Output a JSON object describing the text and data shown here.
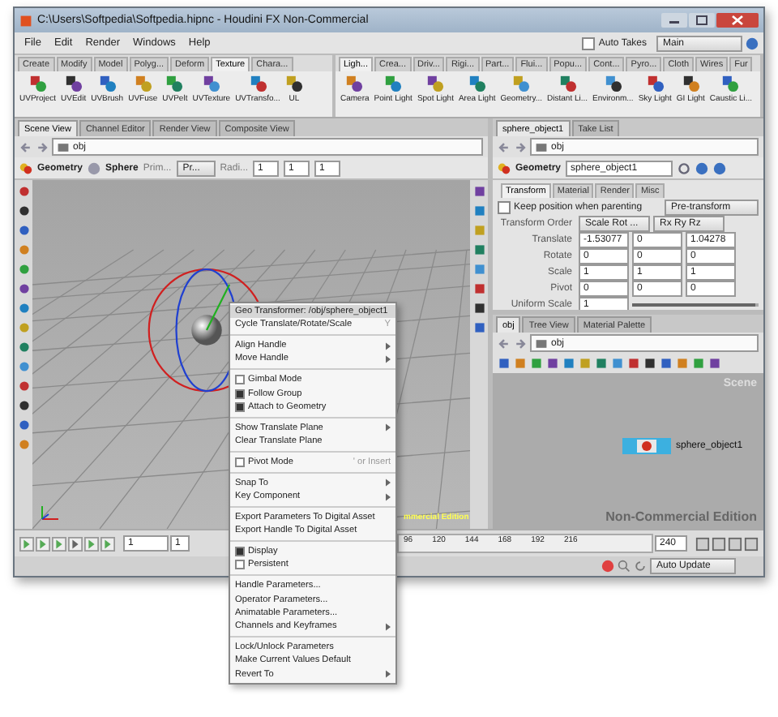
{
  "window": {
    "title": "C:\\Users\\Softpedia\\Softpedia.hipnc - Houdini FX Non-Commercial"
  },
  "menu_bar": [
    "File",
    "Edit",
    "Render",
    "Windows",
    "Help"
  ],
  "auto_takes": {
    "label": "Auto Takes",
    "checked": false
  },
  "take": "Main",
  "shelf_left": {
    "tabs": [
      {
        "label": "Create",
        "selected": false
      },
      {
        "label": "Modify",
        "selected": false
      },
      {
        "label": "Model",
        "selected": false
      },
      {
        "label": "Polyg...",
        "selected": false
      },
      {
        "label": "Deform",
        "selected": false
      },
      {
        "label": "Texture",
        "selected": true
      },
      {
        "label": "Chara...",
        "selected": false
      }
    ],
    "tools": [
      "UVProject",
      "UVEdit",
      "UVBrush",
      "UVFuse",
      "UVPelt",
      "UVTexture",
      "UVTransfo...",
      "UL"
    ]
  },
  "shelf_right": {
    "tabs": [
      {
        "label": "Ligh...",
        "selected": true
      },
      {
        "label": "Crea...",
        "selected": false
      },
      {
        "label": "Driv...",
        "selected": false
      },
      {
        "label": "Rigi...",
        "selected": false
      },
      {
        "label": "Part...",
        "selected": false
      },
      {
        "label": "Flui...",
        "selected": false
      },
      {
        "label": "Popu...",
        "selected": false
      },
      {
        "label": "Cont...",
        "selected": false
      },
      {
        "label": "Pyro...",
        "selected": false
      },
      {
        "label": "Cloth",
        "selected": false
      },
      {
        "label": "Wires",
        "selected": false
      },
      {
        "label": "Fur",
        "selected": false
      }
    ],
    "tools": [
      "Camera",
      "Point Light",
      "Spot Light",
      "Area Light",
      "Geometry...",
      "Distant Li...",
      "Environm...",
      "Sky Light",
      "GI Light",
      "Caustic Li..."
    ]
  },
  "scene_view": {
    "tabs": [
      {
        "label": "Scene View",
        "selected": true
      },
      {
        "label": "Channel Editor",
        "selected": false
      },
      {
        "label": "Render View",
        "selected": false
      },
      {
        "label": "Composite View",
        "selected": false
      }
    ],
    "path": "obj",
    "node_type": "Geometry",
    "shape": "Sphere",
    "prim_label": "Prim...",
    "prim_value": "Pr...",
    "radius_label": "Radi...",
    "radius": [
      "1",
      "1",
      "1"
    ],
    "watermark": "mmercial Edition"
  },
  "parameters": {
    "tabs": [
      {
        "label": "sphere_object1",
        "selected": true
      },
      {
        "label": "Take List",
        "selected": false
      }
    ],
    "path": "obj",
    "node_type": "Geometry",
    "node_name": "sphere_object1",
    "param_tabs": [
      {
        "label": "Transform",
        "selected": true
      },
      {
        "label": "Material",
        "selected": false
      },
      {
        "label": "Render",
        "selected": false
      },
      {
        "label": "Misc",
        "selected": false
      }
    ],
    "keep_position": {
      "label": "Keep position when parenting",
      "checked": false
    },
    "pre_transform": "Pre-transform",
    "transform_order": {
      "label": "Transform Order",
      "values": [
        "Scale Rot ...",
        "Rx Ry Rz"
      ]
    },
    "rows": [
      {
        "label": "Translate",
        "values": [
          "-1.53077",
          "0",
          "1.04278"
        ]
      },
      {
        "label": "Rotate",
        "values": [
          "0",
          "0",
          "0"
        ]
      },
      {
        "label": "Scale",
        "values": [
          "1",
          "1",
          "1"
        ]
      },
      {
        "label": "Pivot",
        "values": [
          "0",
          "0",
          "0"
        ]
      }
    ],
    "uniform_scale": {
      "label": "Uniform Scale",
      "value": "1",
      "level": 0.98
    }
  },
  "network": {
    "tabs": [
      {
        "label": "obj",
        "selected": true
      },
      {
        "label": "Tree View",
        "selected": false
      },
      {
        "label": "Material Palette",
        "selected": false
      }
    ],
    "path": "obj",
    "context": "Scene",
    "node": "sphere_object1",
    "watermark": "Non-Commercial Edition"
  },
  "timeline": {
    "frame": "1",
    "range_start": "1",
    "ticks": [
      "96",
      "120",
      "144",
      "168",
      "192",
      "216"
    ],
    "end": "240"
  },
  "status": {
    "update_mode": "Auto Update"
  },
  "context_menu": [
    {
      "kind": "header",
      "label": "Geo Transformer: /obj/sphere_object1"
    },
    {
      "kind": "item",
      "label": "Cycle Translate/Rotate/Scale",
      "shortcut": "Y",
      "submenu": false
    },
    {
      "kind": "separator"
    },
    {
      "kind": "item",
      "label": "Align Handle",
      "submenu": true
    },
    {
      "kind": "item",
      "label": "Move Handle",
      "submenu": true
    },
    {
      "kind": "separator"
    },
    {
      "kind": "check",
      "label": "Gimbal Mode",
      "checked": false
    },
    {
      "kind": "check",
      "label": "Follow Group",
      "checked": true
    },
    {
      "kind": "check",
      "label": "Attach to Geometry",
      "checked": true
    },
    {
      "kind": "separator"
    },
    {
      "kind": "item",
      "label": "Show Translate Plane",
      "submenu": true
    },
    {
      "kind": "item",
      "label": "Clear Translate Plane",
      "submenu": false
    },
    {
      "kind": "separator"
    },
    {
      "kind": "check",
      "label": "Pivot Mode",
      "checked": false,
      "shortcut": "' or Insert"
    },
    {
      "kind": "separator"
    },
    {
      "kind": "item",
      "label": "Snap To",
      "submenu": true
    },
    {
      "kind": "item",
      "label": "Key Component",
      "submenu": true
    },
    {
      "kind": "separator"
    },
    {
      "kind": "item",
      "label": "Export Parameters To Digital Asset",
      "submenu": false
    },
    {
      "kind": "item",
      "label": "Export Handle To Digital Asset",
      "submenu": false
    },
    {
      "kind": "separator"
    },
    {
      "kind": "check",
      "label": "Display",
      "checked": true
    },
    {
      "kind": "check",
      "label": "Persistent",
      "checked": false
    },
    {
      "kind": "separator"
    },
    {
      "kind": "item",
      "label": "Handle Parameters...",
      "submenu": false
    },
    {
      "kind": "item",
      "label": "Operator Parameters...",
      "submenu": false
    },
    {
      "kind": "item",
      "label": "Animatable Parameters...",
      "submenu": false
    },
    {
      "kind": "item",
      "label": "Channels and Keyframes",
      "submenu": true
    },
    {
      "kind": "separator"
    },
    {
      "kind": "item",
      "label": "Lock/Unlock Parameters",
      "submenu": false
    },
    {
      "kind": "item",
      "label": "Make Current Values Default",
      "submenu": false
    },
    {
      "kind": "item",
      "label": "Revert To",
      "submenu": true
    }
  ]
}
